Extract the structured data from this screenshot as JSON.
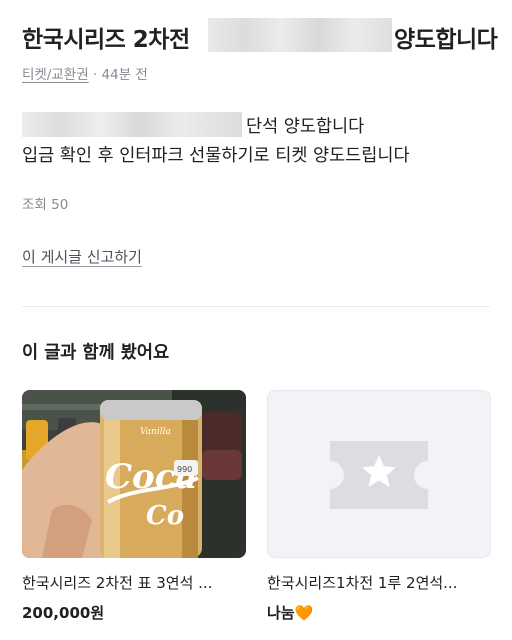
{
  "post": {
    "title_start": "한국시리즈 2차전",
    "title_end": "양도합니다",
    "category": "티켓/교환권",
    "time": "· 44분 전",
    "body_line1_end": "단석 양도합니다",
    "body_line2": "입금 확인 후 인터파크 선물하기로 티켓 양도드립니다",
    "views": "조회 50",
    "report_label": "이 게시글 신고하기"
  },
  "related": {
    "section_title": "이 글과 함께 봤어요",
    "items": [
      {
        "title": "한국시리즈 2차전 표 3연석 ...",
        "price": "200,000원",
        "image": "vanilla-coke-photo"
      },
      {
        "title": "한국시리즈1차전 1루 2연석...",
        "price": "나눔",
        "price_icon": "🧡",
        "image": "ticket-placeholder-icon"
      }
    ]
  },
  "colors": {
    "text": "#212124",
    "meta": "#868b94",
    "placeholder_bg": "#f2f3f6",
    "heart": "#ff8a20"
  }
}
